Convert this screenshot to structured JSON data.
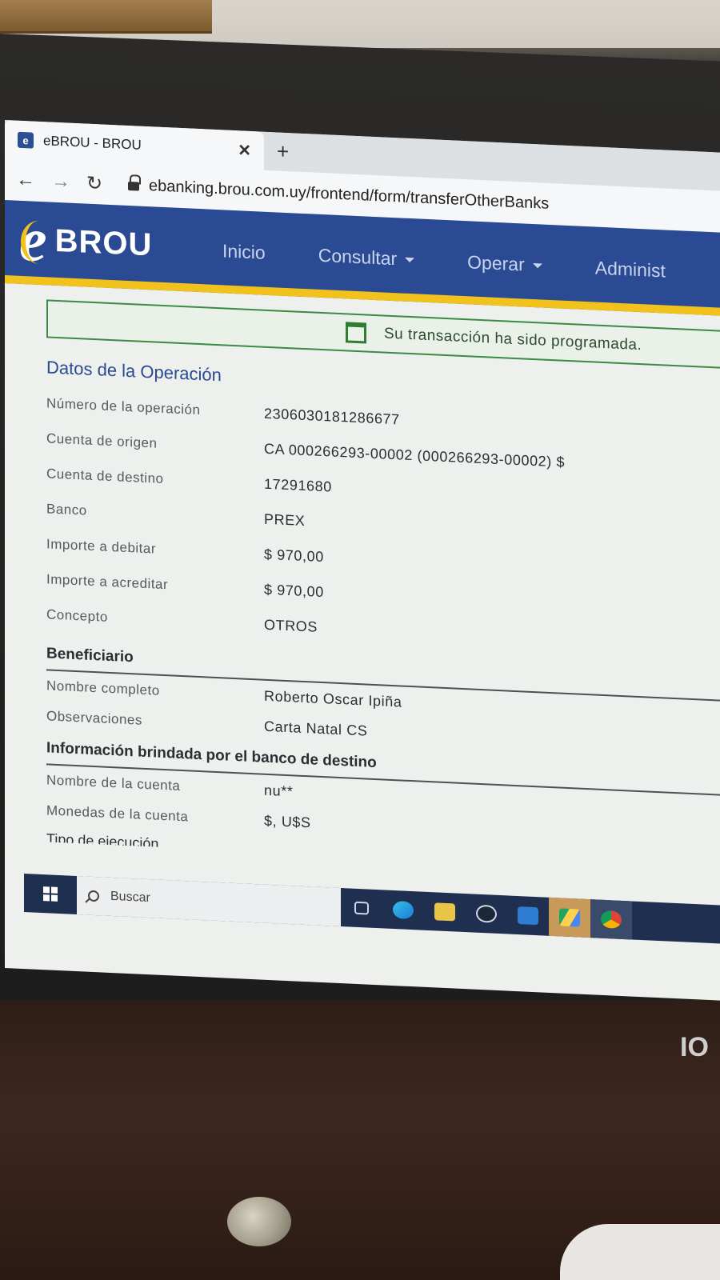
{
  "browser": {
    "tab_title": "eBROU - BROU",
    "url": "ebanking.brou.com.uy/frontend/form/transferOtherBanks"
  },
  "header": {
    "brand": "BROU",
    "nav": [
      {
        "label": "Inicio"
      },
      {
        "label": "Consultar"
      },
      {
        "label": "Operar"
      },
      {
        "label": "Administ"
      }
    ]
  },
  "alert": {
    "message": "Su transacción ha sido programada."
  },
  "operation": {
    "title": "Datos de la Operación",
    "rows": [
      {
        "label": "Número de la operación",
        "value": "2306030181286677"
      },
      {
        "label": "Cuenta de origen",
        "value": "CA 000266293-00002 (000266293-00002) $"
      },
      {
        "label": "Cuenta de destino",
        "value": "17291680"
      },
      {
        "label": "Banco",
        "value": "PREX"
      },
      {
        "label": "Importe a debitar",
        "value": "$ 970,00"
      },
      {
        "label": "Importe a acreditar",
        "value": "$ 970,00"
      },
      {
        "label": "Concepto",
        "value": "OTROS"
      }
    ]
  },
  "beneficiary": {
    "title": "Beneficiario",
    "rows": [
      {
        "label": "Nombre completo",
        "value": "Roberto Oscar Ipiña"
      },
      {
        "label": "Observaciones",
        "value": "Carta Natal CS"
      }
    ]
  },
  "destination_bank": {
    "title": "Información brindada por el banco de destino",
    "rows": [
      {
        "label": "Nombre de la cuenta",
        "value": "nu**"
      },
      {
        "label": "Monedas de la cuenta",
        "value": "$, U$S"
      }
    ],
    "cut_label": "Tipo de ejecución"
  },
  "taskbar": {
    "search_placeholder": "Buscar"
  },
  "monitor_brand": "IO"
}
